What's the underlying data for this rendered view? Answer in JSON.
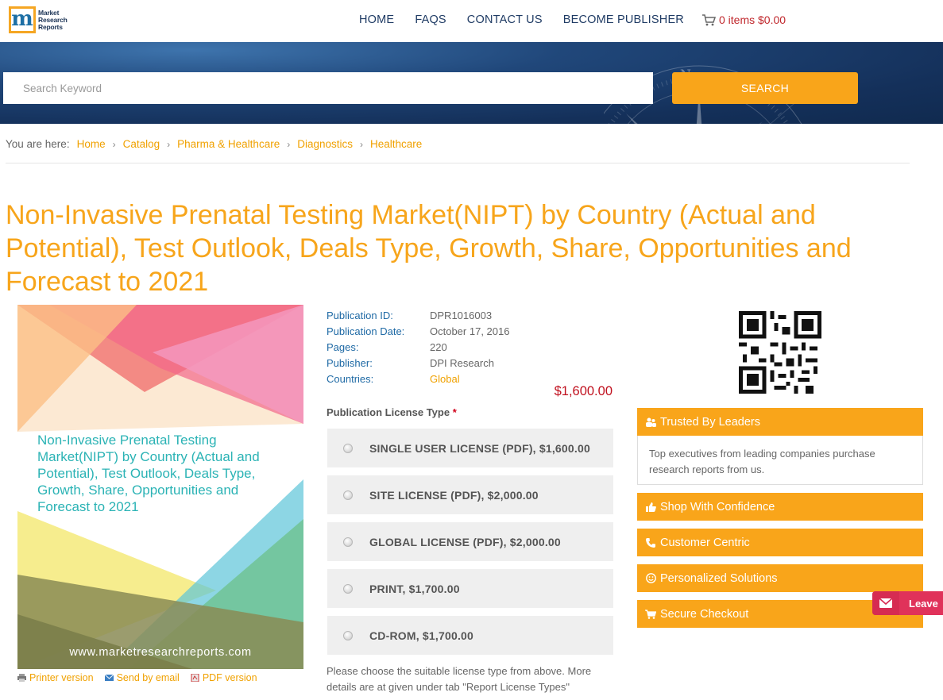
{
  "header": {
    "logo_icon": "m",
    "logo_lines": [
      "Market",
      "Research",
      "Reports"
    ],
    "nav": [
      "HOME",
      "FAQS",
      "CONTACT US",
      "BECOME PUBLISHER"
    ],
    "cart_icon": "cart-icon",
    "cart_text": "0 items $0.00"
  },
  "search": {
    "placeholder": "Search Keyword",
    "button": "SEARCH"
  },
  "breadcrumb": {
    "prefix": "You are here:",
    "items": [
      "Home",
      "Catalog",
      "Pharma & Healthcare",
      "Diagnostics",
      "Healthcare"
    ]
  },
  "page_title": "Non-Invasive Prenatal Testing Market(NIPT) by Country (Actual and Potential), Test Outlook, Deals Type, Growth, Share, Opportunities and Forecast to 2021",
  "cover": {
    "title": "Non-Invasive Prenatal Testing Market(NIPT) by Country (Actual and Potential), Test Outlook, Deals Type, Growth, Share, Opportunities and Forecast to 2021",
    "url": "www.marketresearchreports.com"
  },
  "cover_links": [
    "Printer version",
    "Send by email",
    "PDF version"
  ],
  "meta": [
    {
      "key": "Publication ID:",
      "value": "DPR1016003"
    },
    {
      "key": "Publication Date:",
      "value": "October 17, 2016"
    },
    {
      "key": "Pages:",
      "value": "220"
    },
    {
      "key": "Publisher:",
      "value": "DPI Research"
    },
    {
      "key": "Countries:",
      "value": "Global"
    }
  ],
  "price": "$1,600.00",
  "license": {
    "label": "Publication License Type",
    "required": "*",
    "options": [
      "SINGLE USER LICENSE (PDF), $1,600.00",
      "SITE LICENSE (PDF), $2,000.00",
      "GLOBAL LICENSE (PDF), $2,000.00",
      "PRINT, $1,700.00",
      "CD-ROM, $1,700.00"
    ],
    "note": "Please choose the suitable license type from above. More details are at given under tab \"Report License Types\""
  },
  "side": {
    "trusted_title": "Trusted By Leaders",
    "trusted_body": "Top executives from leading companies purchase research reports from us.",
    "bars": [
      "Shop With Confidence",
      "Customer Centric",
      "Personalized Solutions",
      "Secure Checkout"
    ]
  },
  "leave_button": "Leave",
  "colors": {
    "accent": "#f9a51a",
    "nav": "#1f3b64",
    "price": "#c0101e",
    "link": "#f0a100"
  }
}
